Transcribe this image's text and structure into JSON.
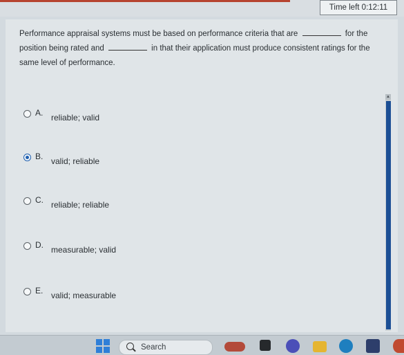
{
  "header": {
    "timer_label": "Time left",
    "timer_value": "0:12:11"
  },
  "question": {
    "part1": "Performance appraisal systems must be based on performance criteria that are",
    "part2": "for the position being rated and",
    "part3": "in that their application must produce consistent ratings for the same level of performance."
  },
  "options": [
    {
      "letter": "A.",
      "text": "reliable; valid",
      "selected": false
    },
    {
      "letter": "B.",
      "text": "valid; reliable",
      "selected": true
    },
    {
      "letter": "C.",
      "text": "reliable; reliable",
      "selected": false
    },
    {
      "letter": "D.",
      "text": "measurable; valid",
      "selected": false
    },
    {
      "letter": "E.",
      "text": "valid; measurable",
      "selected": false
    }
  ],
  "taskbar": {
    "search_placeholder": "Search"
  },
  "colors": {
    "accent": "#1f5fb0",
    "scrollbar": "#1c4f95",
    "topbar_stripe": "#b6432f"
  }
}
